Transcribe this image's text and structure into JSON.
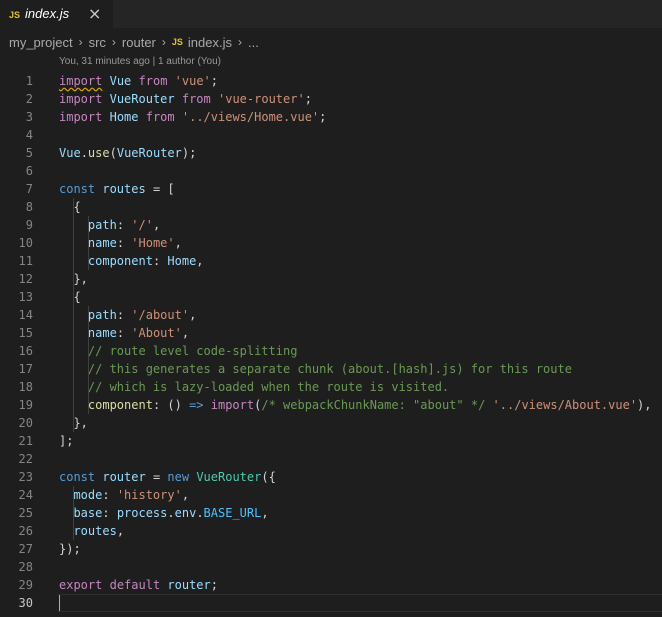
{
  "tab": {
    "badge": "JS",
    "title": "index.js",
    "close": "×"
  },
  "breadcrumb": {
    "items": [
      "my_project",
      "src",
      "router"
    ],
    "file_badge": "JS",
    "file": "index.js",
    "more": "...",
    "separator": "›"
  },
  "codelens": "You, 31 minutes ago | 1 author (You)",
  "lines": [
    {
      "n": "1",
      "tokens": [
        [
          "kw",
          "import"
        ],
        [
          "",
          "",
          ""
        ],
        [
          "sq",
          " "
        ],
        [
          "var",
          "Vue"
        ],
        [
          "",
          " "
        ],
        [
          "kw",
          "from"
        ],
        [
          "",
          " "
        ],
        [
          "str",
          "'vue'"
        ],
        [
          "",
          ";"
        ]
      ]
    }
  ],
  "line_numbers": [
    "1",
    "2",
    "3",
    "4",
    "5",
    "6",
    "7",
    "8",
    "9",
    "10",
    "11",
    "12",
    "13",
    "14",
    "15",
    "16",
    "17",
    "18",
    "19",
    "20",
    "21",
    "22",
    "23",
    "24",
    "25",
    "26",
    "27",
    "28",
    "29",
    "30"
  ],
  "current_line": "30",
  "code_lines": [
    [
      [
        "kw",
        "import"
      ],
      [
        "",
        " "
      ],
      [
        "var",
        "Vue"
      ],
      [
        "",
        " "
      ],
      [
        "kw",
        "from"
      ],
      [
        "",
        " "
      ],
      [
        "str",
        "'vue'"
      ],
      [
        "",
        ";"
      ]
    ],
    [
      [
        "kw",
        "import"
      ],
      [
        "",
        " "
      ],
      [
        "var",
        "VueRouter"
      ],
      [
        "",
        " "
      ],
      [
        "kw",
        "from"
      ],
      [
        "",
        " "
      ],
      [
        "str",
        "'vue-router'"
      ],
      [
        "",
        ";"
      ]
    ],
    [
      [
        "kw",
        "import"
      ],
      [
        "",
        " "
      ],
      [
        "var",
        "Home"
      ],
      [
        "",
        " "
      ],
      [
        "kw",
        "from"
      ],
      [
        "",
        " "
      ],
      [
        "str",
        "'../views/Home.vue'"
      ],
      [
        "",
        ";"
      ]
    ],
    [],
    [
      [
        "var",
        "Vue"
      ],
      [
        "",
        "."
      ],
      [
        "fn",
        "use"
      ],
      [
        "",
        "("
      ],
      [
        "var",
        "VueRouter"
      ],
      [
        "",
        ");"
      ]
    ],
    [],
    [
      [
        "kw2",
        "const"
      ],
      [
        "",
        " "
      ],
      [
        "var",
        "routes"
      ],
      [
        "",
        " = ["
      ]
    ],
    [
      [
        "",
        "  {"
      ]
    ],
    [
      [
        "",
        "    "
      ],
      [
        "var",
        "path"
      ],
      [
        "",
        ": "
      ],
      [
        "str",
        "'/'"
      ],
      [
        "",
        ","
      ]
    ],
    [
      [
        "",
        "    "
      ],
      [
        "var",
        "name"
      ],
      [
        "",
        ": "
      ],
      [
        "str",
        "'Home'"
      ],
      [
        "",
        ","
      ]
    ],
    [
      [
        "",
        "    "
      ],
      [
        "var",
        "component"
      ],
      [
        "",
        ": "
      ],
      [
        "var",
        "Home"
      ],
      [
        "",
        ","
      ]
    ],
    [
      [
        "",
        "  },"
      ]
    ],
    [
      [
        "",
        "  {"
      ]
    ],
    [
      [
        "",
        "    "
      ],
      [
        "var",
        "path"
      ],
      [
        "",
        ": "
      ],
      [
        "str",
        "'/about'"
      ],
      [
        "",
        ","
      ]
    ],
    [
      [
        "",
        "    "
      ],
      [
        "var",
        "name"
      ],
      [
        "",
        ": "
      ],
      [
        "str",
        "'About'"
      ],
      [
        "",
        ","
      ]
    ],
    [
      [
        "",
        "    "
      ],
      [
        "com",
        "// route level code-splitting"
      ]
    ],
    [
      [
        "",
        "    "
      ],
      [
        "com",
        "// this generates a separate chunk (about.[hash].js) for this route"
      ]
    ],
    [
      [
        "",
        "    "
      ],
      [
        "com",
        "// which is lazy-loaded when the route is visited."
      ]
    ],
    [
      [
        "",
        "    "
      ],
      [
        "fn",
        "component"
      ],
      [
        "",
        ": () "
      ],
      [
        "kw2",
        "=>"
      ],
      [
        "",
        " "
      ],
      [
        "kw",
        "import"
      ],
      [
        "",
        "("
      ],
      [
        "com",
        "/* webpackChunkName: \"about\" */"
      ],
      [
        "",
        " "
      ],
      [
        "str",
        "'../views/About.vue'"
      ],
      [
        "",
        "),"
      ]
    ],
    [
      [
        "",
        "  },"
      ]
    ],
    [
      [
        "",
        "];"
      ]
    ],
    [],
    [
      [
        "kw2",
        "const"
      ],
      [
        "",
        " "
      ],
      [
        "var",
        "router"
      ],
      [
        "",
        " = "
      ],
      [
        "kw2",
        "new"
      ],
      [
        "",
        " "
      ],
      [
        "cls",
        "VueRouter"
      ],
      [
        "",
        "({"
      ]
    ],
    [
      [
        "",
        "  "
      ],
      [
        "var",
        "mode"
      ],
      [
        "",
        ": "
      ],
      [
        "str",
        "'history'"
      ],
      [
        "",
        ","
      ]
    ],
    [
      [
        "",
        "  "
      ],
      [
        "var",
        "base"
      ],
      [
        "",
        ": "
      ],
      [
        "var",
        "process"
      ],
      [
        "",
        "."
      ],
      [
        "var",
        "env"
      ],
      [
        "",
        "."
      ],
      [
        "const",
        "BASE_URL"
      ],
      [
        "",
        ","
      ]
    ],
    [
      [
        "",
        "  "
      ],
      [
        "var",
        "routes"
      ],
      [
        "",
        ","
      ]
    ],
    [
      [
        "",
        "});"
      ]
    ],
    [],
    [
      [
        "kw",
        "export"
      ],
      [
        "",
        " "
      ],
      [
        "kw",
        "default"
      ],
      [
        "",
        " "
      ],
      [
        "var",
        "router"
      ],
      [
        "",
        ";"
      ]
    ],
    []
  ],
  "colors": {
    "background": "#1e1e1e",
    "tabbar": "#252526",
    "keyword": "#c586c0",
    "storage": "#569cd6",
    "variable": "#9cdcfe",
    "class": "#4ec9b0",
    "function": "#dcdcaa",
    "string": "#ce9178",
    "comment": "#6a9955",
    "js_badge": "#e2c22f"
  }
}
